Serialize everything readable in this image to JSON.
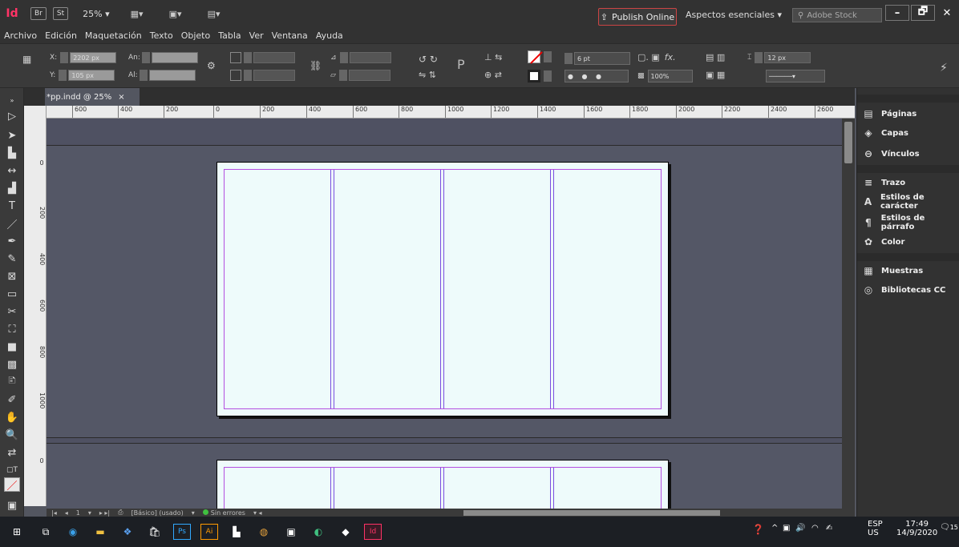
{
  "app": {
    "logo": "Id",
    "bridge_label": "Br",
    "stock_label": "St",
    "zoom": "25%",
    "publish_label": "Publish Online",
    "workspace": "Aspectos esenciales",
    "stock_search_placeholder": "Adobe Stock",
    "window_minimize": "–",
    "window_restore": "🗗",
    "window_close": "✕"
  },
  "menu": [
    "Archivo",
    "Edición",
    "Maquetación",
    "Texto",
    "Objeto",
    "Tabla",
    "Ver",
    "Ventana",
    "Ayuda"
  ],
  "control_panel": {
    "x_label": "X:",
    "x_value": "2202 px",
    "y_label": "Y:",
    "y_value": "105 px",
    "w_label": "An:",
    "h_label": "Al:",
    "stroke_weight": "6 pt",
    "opacity": "100%",
    "gutter": "12 px",
    "fx_label": "fx."
  },
  "document": {
    "tab_title": "*pp.indd @ 25%",
    "tab_close": "×"
  },
  "ruler": {
    "h_ticks": [
      "600",
      "400",
      "200",
      "0",
      "200",
      "400",
      "600",
      "800",
      "1000",
      "1200",
      "1400",
      "1600",
      "1800",
      "2000",
      "2200",
      "2400",
      "2600"
    ],
    "v_ticks": [
      "0",
      "200",
      "400",
      "600",
      "800",
      "1000",
      "0"
    ]
  },
  "status": {
    "page_number": "1",
    "style": "[Básico] (usado)",
    "preflight": "Sin errores"
  },
  "panels": [
    {
      "label": "Páginas",
      "icon": "pages-icon"
    },
    {
      "label": "Capas",
      "icon": "layers-icon"
    },
    {
      "label": "Vínculos",
      "icon": "links-icon"
    },
    {
      "label": "Trazo",
      "icon": "stroke-icon"
    },
    {
      "label": "Estilos de carácter",
      "icon": "character-styles-icon"
    },
    {
      "label": "Estilos de párrafo",
      "icon": "paragraph-styles-icon"
    },
    {
      "label": "Color",
      "icon": "color-icon"
    },
    {
      "label": "Muestras",
      "icon": "swatches-icon"
    },
    {
      "label": "Bibliotecas CC",
      "icon": "cc-libraries-icon"
    }
  ],
  "taskbar": {
    "lang_top": "ESP",
    "lang_bottom": "US",
    "time": "17:49",
    "date": "14/9/2020",
    "notifications": "15"
  },
  "colors": {
    "indesign_pink": "#ff3366",
    "margin_guide": "#b44ee0",
    "page_fill": "#eefbfb",
    "pasteboard": "#545766"
  }
}
